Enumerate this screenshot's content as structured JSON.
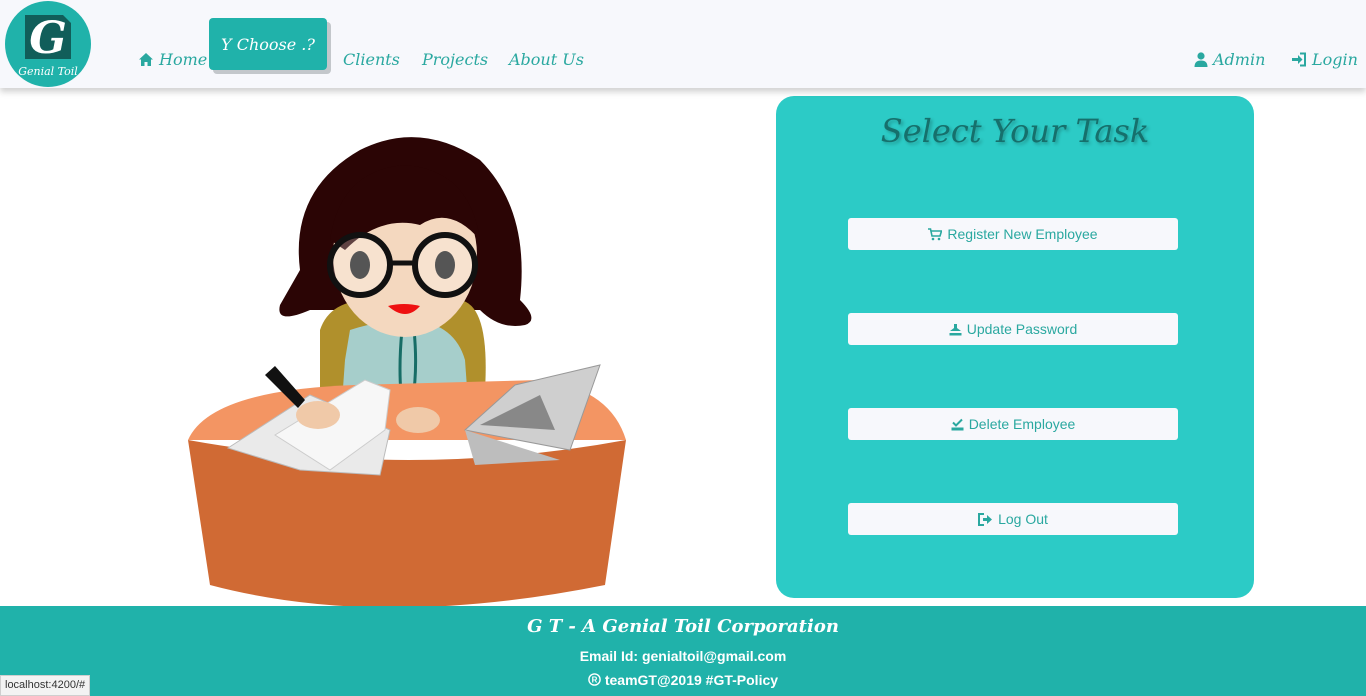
{
  "nav": {
    "logo_text": "Genial Toil",
    "logo_letter": "G",
    "home": "Home",
    "active": "Y Choose .?",
    "clients": "Clients",
    "projects": "Projects",
    "about": "About Us",
    "admin": "Admin",
    "login": "Login"
  },
  "card": {
    "title": "Select Your Task",
    "buttons": [
      {
        "label": "Register New Employee",
        "icon": "cart-icon"
      },
      {
        "label": "Update Password",
        "icon": "stamp-icon"
      },
      {
        "label": "Delete Employee",
        "icon": "check-tray-icon"
      },
      {
        "label": "Log Out",
        "icon": "logout-icon"
      }
    ]
  },
  "footer": {
    "corp": "G T - A Genial Toil Corporation",
    "email": "Email Id: genialtoil@gmail.com",
    "copyright": "teamGT@2019 #GT-Policy"
  },
  "status_bar": "localhost:4200/#",
  "colors": {
    "accent": "#20b2aa",
    "card": "#2ccbc6",
    "header_bg": "#f7f8fc"
  }
}
